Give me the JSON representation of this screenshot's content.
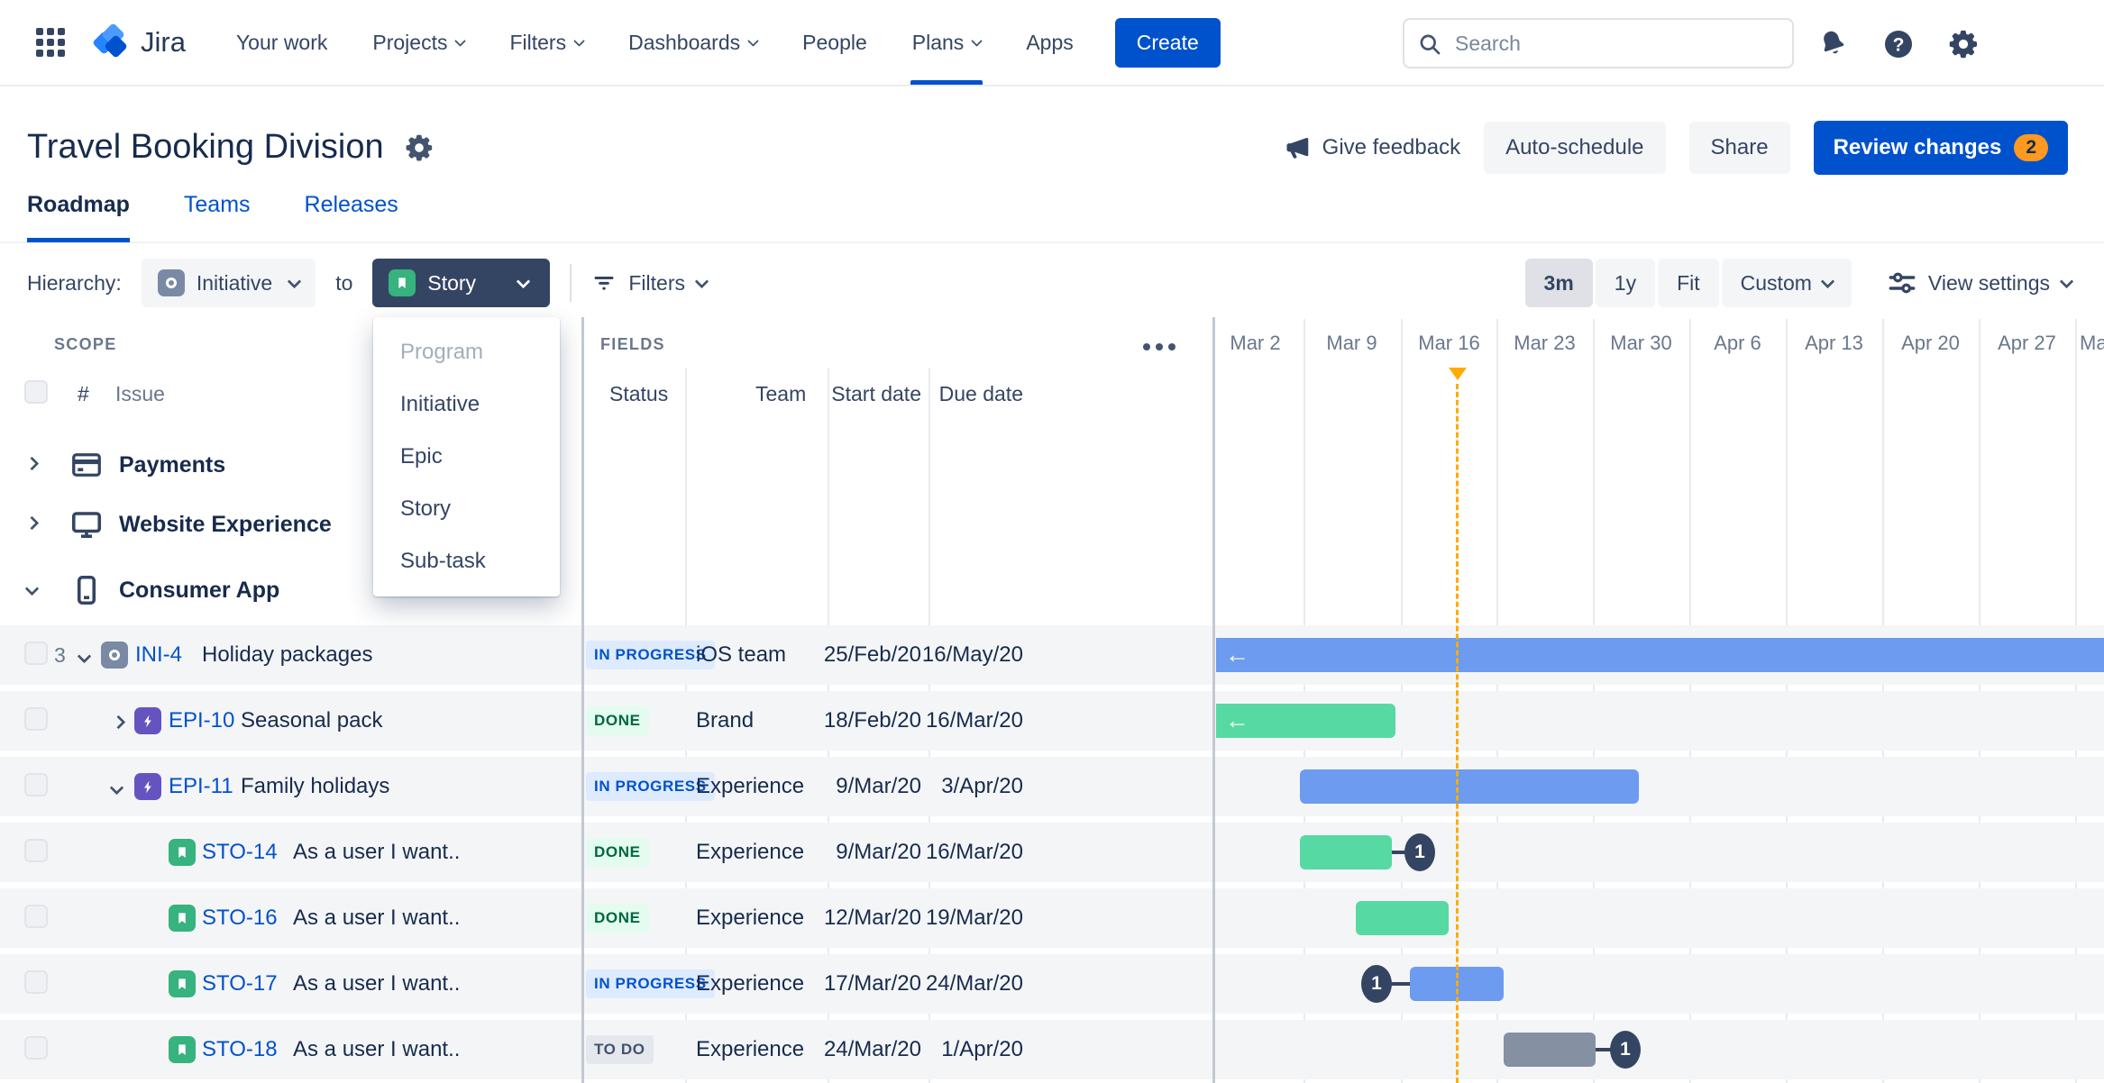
{
  "nav": {
    "logo_text": "Jira",
    "items": [
      {
        "label": "Your work"
      },
      {
        "label": "Projects"
      },
      {
        "label": "Filters"
      },
      {
        "label": "Dashboards"
      },
      {
        "label": "People"
      },
      {
        "label": "Plans"
      },
      {
        "label": "Apps"
      }
    ],
    "create_label": "Create",
    "search_placeholder": "Search"
  },
  "header": {
    "title": "Travel Booking Division",
    "give_feedback": "Give feedback",
    "auto_schedule": "Auto-schedule",
    "share": "Share",
    "review_changes": "Review changes",
    "review_badge": "2"
  },
  "tabs": [
    {
      "label": "Roadmap"
    },
    {
      "label": "Teams"
    },
    {
      "label": "Releases"
    }
  ],
  "toolbar": {
    "hierarchy_label": "Hierarchy:",
    "from_type": "Initiative",
    "to_word": "to",
    "to_type": "Story",
    "filters_label": "Filters",
    "zoom": {
      "m3": "3m",
      "y1": "1y",
      "fit": "Fit",
      "custom": "Custom"
    },
    "view_settings_label": "View settings"
  },
  "type_dropdown": {
    "items": [
      "Program",
      "Initiative",
      "Epic",
      "Story",
      "Sub-task"
    ]
  },
  "scope": {
    "section_label": "SCOPE",
    "hash_header": "#",
    "issue_header": "Issue",
    "groups": [
      {
        "name": "Payments"
      },
      {
        "name": "Website Experience"
      },
      {
        "name": "Consumer App"
      }
    ]
  },
  "fields": {
    "section_label": "FIELDS",
    "columns": {
      "status": "Status",
      "team": "Team",
      "start": "Start date",
      "due": "Due date"
    }
  },
  "timeline": {
    "weeks": [
      "Mar 2",
      "Mar 9",
      "Mar 16",
      "Mar 23",
      "Mar 30",
      "Apr 6",
      "Apr 13",
      "Apr 20",
      "Apr 27",
      "May"
    ]
  },
  "rows": [
    {
      "key": "INI-4",
      "type": "initiative",
      "summary": "Holiday packages",
      "status": "IN PROGRESS",
      "team": "iOS team",
      "start": "25/Feb/20",
      "due": "16/May/20",
      "count": "3"
    },
    {
      "key": "EPI-10",
      "type": "epic",
      "summary": "Seasonal pack",
      "status": "DONE",
      "team": "Brand",
      "start": "18/Feb/20",
      "due": "16/Mar/20"
    },
    {
      "key": "EPI-11",
      "type": "epic",
      "summary": "Family holidays",
      "status": "IN PROGRESS",
      "team": "Experience",
      "start": "9/Mar/20",
      "due": "3/Apr/20"
    },
    {
      "key": "STO-14",
      "type": "story",
      "summary": "As a user I want..",
      "status": "DONE",
      "team": "Experience",
      "start": "9/Mar/20",
      "due": "16/Mar/20",
      "dependencies": "1"
    },
    {
      "key": "STO-16",
      "type": "story",
      "summary": "As a user I want..",
      "status": "DONE",
      "team": "Experience",
      "start": "12/Mar/20",
      "due": "19/Mar/20"
    },
    {
      "key": "STO-17",
      "type": "story",
      "summary": "As a user I want..",
      "status": "IN PROGRESS",
      "team": "Experience",
      "start": "17/Mar/20",
      "due": "24/Mar/20",
      "dependencies": "1"
    },
    {
      "key": "STO-18",
      "type": "story",
      "summary": "As a user I want..",
      "status": "TO DO",
      "team": "Experience",
      "start": "24/Mar/20",
      "due": "1/Apr/20",
      "dependencies": "1"
    }
  ],
  "colors": {
    "primary_blue": "#0052CC",
    "bar_blue": "#6C9BF0",
    "bar_green": "#57D9A3",
    "bar_gray": "#8590A2",
    "today_marker": "#FFAB00",
    "review_badge_bg": "#FF991F",
    "status_inprogress_bg": "#DEEBFF",
    "status_inprogress_text": "#0052CC",
    "status_done_bg": "#E3FCEF",
    "status_done_text": "#006644",
    "status_todo_bg": "#E4E7EC",
    "status_todo_text": "#42526E",
    "epic_purple": "#6554C0",
    "story_green": "#36B37E",
    "initiative_slate": "#7A8AA5"
  }
}
